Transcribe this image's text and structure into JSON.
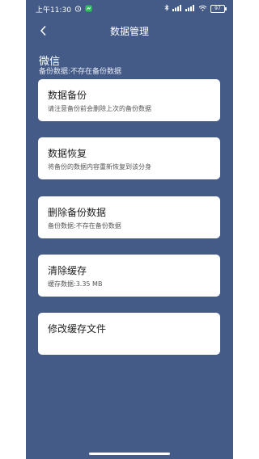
{
  "status_bar": {
    "time": "上午11:30",
    "battery": "97"
  },
  "header": {
    "title": "数据管理"
  },
  "app": {
    "name": "微信",
    "backup_status": "备份数据:不存在备份数据"
  },
  "cards": [
    {
      "title": "数据备份",
      "desc": "请注意备份前会删除上次的备份数据"
    },
    {
      "title": "数据恢复",
      "desc": "将备份的数据内容重新恢复到该分身"
    },
    {
      "title": "删除备份数据",
      "desc": "备份数据:不存在备份数据"
    },
    {
      "title": "清除缓存",
      "desc": "缓存数据:3.35 MB"
    },
    {
      "title": "修改缓存文件",
      "desc": ""
    }
  ],
  "colors": {
    "background": "#445a87",
    "card": "#ffffff"
  }
}
